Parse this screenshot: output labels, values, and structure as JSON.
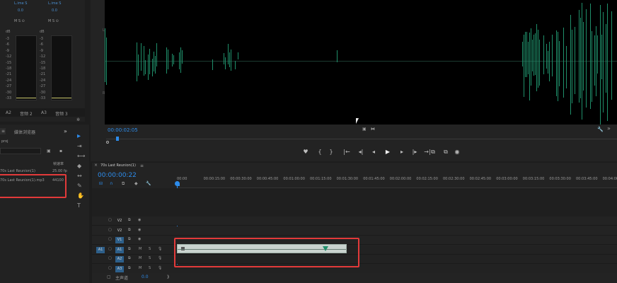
{
  "mixer": {
    "ch1_name": "L.ime S",
    "ch2_name": "L.ime S",
    "ch1_value": "0.0",
    "ch2_value": "0.0",
    "ch1_btns": "M S ⊙",
    "ch2_btns": "M S ⊙",
    "scale": [
      "dB",
      "-3",
      "-6",
      "-9",
      "-12",
      "-15",
      "-18",
      "-21",
      "-24",
      "-27",
      "-30",
      "-33"
    ],
    "scale_top": "dB",
    "ch1_track": "A2",
    "ch1_label": "音频 2",
    "ch2_track": "A3",
    "ch2_label": "音频 3"
  },
  "project_panel": {
    "tab_label": "媒体浏览器",
    "tab_menu": "≡",
    "project_file": "proj",
    "column_header": "帧速率",
    "items": [
      {
        "name": "70s Last Reunion(1)",
        "rate": "25.00 fp"
      },
      {
        "name": "70s Last Reunion(1).mp3",
        "rate": "44100"
      }
    ]
  },
  "tools": {
    "selection": "▸",
    "track_select": "⇥",
    "ripple": "⟷",
    "razor": "◆",
    "slip": "↔",
    "pen": "✎",
    "hand": "✋",
    "type": "T"
  },
  "source_monitor": {
    "timecode": "00:00:02:05",
    "wave_scale_1": "L",
    "wave_scale_2": "R",
    "controls": [
      "♥",
      "{",
      "}",
      "|←",
      "◂|",
      "◂",
      "▶",
      "▸",
      "|▸",
      "→|",
      "⧉",
      "⧉",
      "◉"
    ]
  },
  "timeline": {
    "sequence_name": "70s Last Reunion(1)",
    "menu_icon": "≡",
    "timecode": "00:00:00:22",
    "ruler": [
      "00:00",
      "00:00:15:00",
      "00:00:30:00",
      "00:00:45:00",
      "00:01:00:00",
      "00:01:15:00",
      "00:01:30:00",
      "00:01:45:00",
      "00:02:00:00",
      "00:02:15:00",
      "00:02:30:00",
      "00:02:45:00",
      "00:03:00:00",
      "00:03:15:00",
      "00:03:30:00",
      "00:03:45:00",
      "00:04:00:00"
    ],
    "tracks": [
      {
        "id": "V2",
        "kind": "video"
      },
      {
        "id": "V2",
        "kind": "video"
      },
      {
        "id": "V1",
        "kind": "video"
      },
      {
        "id": "A1",
        "kind": "audio",
        "source": "A1"
      },
      {
        "id": "A2",
        "kind": "audio"
      },
      {
        "id": "A3",
        "kind": "audio"
      }
    ],
    "mute": "M",
    "solo": "S",
    "lock": "🔒",
    "eye": "👁",
    "mic": "🎙",
    "master_label": "主声道",
    "master_value": "0.0"
  },
  "colors": {
    "bg": "#1d1d1d",
    "panel": "#232323",
    "accent_blue": "#2d8ceb",
    "waveform": "#1f8f6a",
    "highlight": "#e23a3a"
  }
}
